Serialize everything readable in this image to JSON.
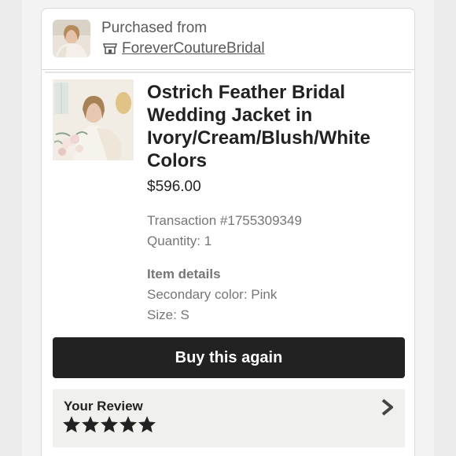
{
  "shop": {
    "purchased_label": "Purchased from",
    "shop_name": "ForeverCoutureBridal"
  },
  "product": {
    "title": "Ostrich Feather Bridal Wedding Jacket in Ivory/Cream/Blush/White Colors",
    "price": "$596.00"
  },
  "transaction": {
    "number": "Transaction #1755309349",
    "quantity": "Quantity: 1"
  },
  "item_details": {
    "heading": "Item details",
    "secondary_color": "Secondary color: Pink",
    "size": "Size: S"
  },
  "actions": {
    "buy_again_label": "Buy this again"
  },
  "review": {
    "label": "Your Review",
    "rating": 5,
    "max_rating": 5
  },
  "icons": {
    "shop": "store-icon",
    "review_arrow": "chevron-right-icon",
    "rating": "star-icon"
  },
  "colors": {
    "button_bg": "#222222",
    "review_bg": "#f0f0ec",
    "muted_text": "#767676"
  }
}
